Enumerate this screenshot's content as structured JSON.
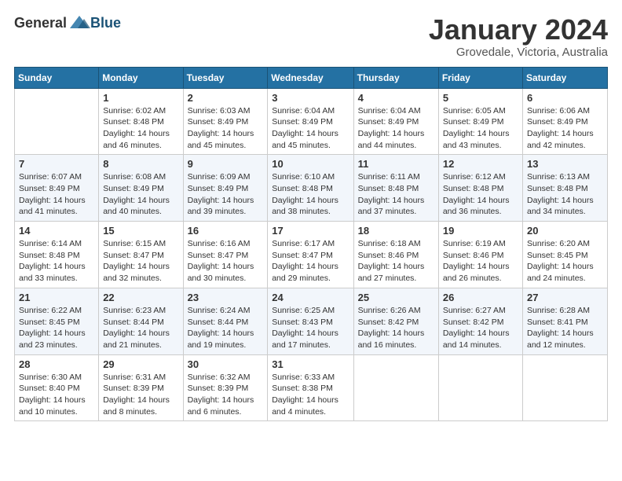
{
  "logo": {
    "general": "General",
    "blue": "Blue"
  },
  "title": "January 2024",
  "subtitle": "Grovedale, Victoria, Australia",
  "weekdays": [
    "Sunday",
    "Monday",
    "Tuesday",
    "Wednesday",
    "Thursday",
    "Friday",
    "Saturday"
  ],
  "weeks": [
    [
      null,
      {
        "day": 1,
        "sunrise": "6:02 AM",
        "sunset": "8:48 PM",
        "daylight": "14 hours and 46 minutes."
      },
      {
        "day": 2,
        "sunrise": "6:03 AM",
        "sunset": "8:49 PM",
        "daylight": "14 hours and 45 minutes."
      },
      {
        "day": 3,
        "sunrise": "6:04 AM",
        "sunset": "8:49 PM",
        "daylight": "14 hours and 45 minutes."
      },
      {
        "day": 4,
        "sunrise": "6:04 AM",
        "sunset": "8:49 PM",
        "daylight": "14 hours and 44 minutes."
      },
      {
        "day": 5,
        "sunrise": "6:05 AM",
        "sunset": "8:49 PM",
        "daylight": "14 hours and 43 minutes."
      },
      {
        "day": 6,
        "sunrise": "6:06 AM",
        "sunset": "8:49 PM",
        "daylight": "14 hours and 42 minutes."
      }
    ],
    [
      {
        "day": 7,
        "sunrise": "6:07 AM",
        "sunset": "8:49 PM",
        "daylight": "14 hours and 41 minutes."
      },
      {
        "day": 8,
        "sunrise": "6:08 AM",
        "sunset": "8:49 PM",
        "daylight": "14 hours and 40 minutes."
      },
      {
        "day": 9,
        "sunrise": "6:09 AM",
        "sunset": "8:49 PM",
        "daylight": "14 hours and 39 minutes."
      },
      {
        "day": 10,
        "sunrise": "6:10 AM",
        "sunset": "8:48 PM",
        "daylight": "14 hours and 38 minutes."
      },
      {
        "day": 11,
        "sunrise": "6:11 AM",
        "sunset": "8:48 PM",
        "daylight": "14 hours and 37 minutes."
      },
      {
        "day": 12,
        "sunrise": "6:12 AM",
        "sunset": "8:48 PM",
        "daylight": "14 hours and 36 minutes."
      },
      {
        "day": 13,
        "sunrise": "6:13 AM",
        "sunset": "8:48 PM",
        "daylight": "14 hours and 34 minutes."
      }
    ],
    [
      {
        "day": 14,
        "sunrise": "6:14 AM",
        "sunset": "8:48 PM",
        "daylight": "14 hours and 33 minutes."
      },
      {
        "day": 15,
        "sunrise": "6:15 AM",
        "sunset": "8:47 PM",
        "daylight": "14 hours and 32 minutes."
      },
      {
        "day": 16,
        "sunrise": "6:16 AM",
        "sunset": "8:47 PM",
        "daylight": "14 hours and 30 minutes."
      },
      {
        "day": 17,
        "sunrise": "6:17 AM",
        "sunset": "8:47 PM",
        "daylight": "14 hours and 29 minutes."
      },
      {
        "day": 18,
        "sunrise": "6:18 AM",
        "sunset": "8:46 PM",
        "daylight": "14 hours and 27 minutes."
      },
      {
        "day": 19,
        "sunrise": "6:19 AM",
        "sunset": "8:46 PM",
        "daylight": "14 hours and 26 minutes."
      },
      {
        "day": 20,
        "sunrise": "6:20 AM",
        "sunset": "8:45 PM",
        "daylight": "14 hours and 24 minutes."
      }
    ],
    [
      {
        "day": 21,
        "sunrise": "6:22 AM",
        "sunset": "8:45 PM",
        "daylight": "14 hours and 23 minutes."
      },
      {
        "day": 22,
        "sunrise": "6:23 AM",
        "sunset": "8:44 PM",
        "daylight": "14 hours and 21 minutes."
      },
      {
        "day": 23,
        "sunrise": "6:24 AM",
        "sunset": "8:44 PM",
        "daylight": "14 hours and 19 minutes."
      },
      {
        "day": 24,
        "sunrise": "6:25 AM",
        "sunset": "8:43 PM",
        "daylight": "14 hours and 17 minutes."
      },
      {
        "day": 25,
        "sunrise": "6:26 AM",
        "sunset": "8:42 PM",
        "daylight": "14 hours and 16 minutes."
      },
      {
        "day": 26,
        "sunrise": "6:27 AM",
        "sunset": "8:42 PM",
        "daylight": "14 hours and 14 minutes."
      },
      {
        "day": 27,
        "sunrise": "6:28 AM",
        "sunset": "8:41 PM",
        "daylight": "14 hours and 12 minutes."
      }
    ],
    [
      {
        "day": 28,
        "sunrise": "6:30 AM",
        "sunset": "8:40 PM",
        "daylight": "14 hours and 10 minutes."
      },
      {
        "day": 29,
        "sunrise": "6:31 AM",
        "sunset": "8:39 PM",
        "daylight": "14 hours and 8 minutes."
      },
      {
        "day": 30,
        "sunrise": "6:32 AM",
        "sunset": "8:39 PM",
        "daylight": "14 hours and 6 minutes."
      },
      {
        "day": 31,
        "sunrise": "6:33 AM",
        "sunset": "8:38 PM",
        "daylight": "14 hours and 4 minutes."
      },
      null,
      null,
      null
    ]
  ]
}
